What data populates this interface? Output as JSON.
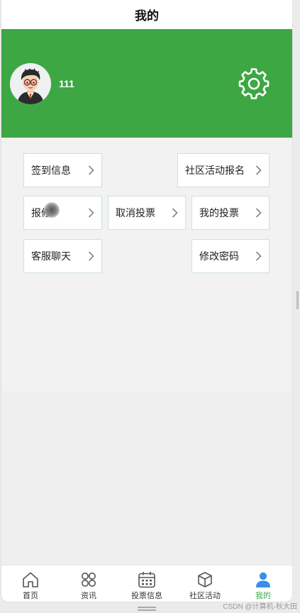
{
  "header": {
    "title": "我的"
  },
  "profile": {
    "username": "111"
  },
  "menu": {
    "checkin": "签到信息",
    "event_signup": "社区活动报名",
    "repair": "报修",
    "cancel_vote": "取消投票",
    "my_votes": "我的投票",
    "customer_chat": "客服聊天",
    "change_password": "修改密码"
  },
  "tabs": [
    {
      "label": "首页",
      "icon": "home-icon"
    },
    {
      "label": "资讯",
      "icon": "news-icon"
    },
    {
      "label": "投票信息",
      "icon": "calendar-icon"
    },
    {
      "label": "社区活动",
      "icon": "cube-icon"
    },
    {
      "label": "我的",
      "icon": "person-icon",
      "active": true
    }
  ],
  "watermark": "CSDN @计算机-秋大田",
  "colors": {
    "brand_green": "#3da744",
    "tab_active": "#3da744",
    "cell_border": "#cfe3cf"
  }
}
